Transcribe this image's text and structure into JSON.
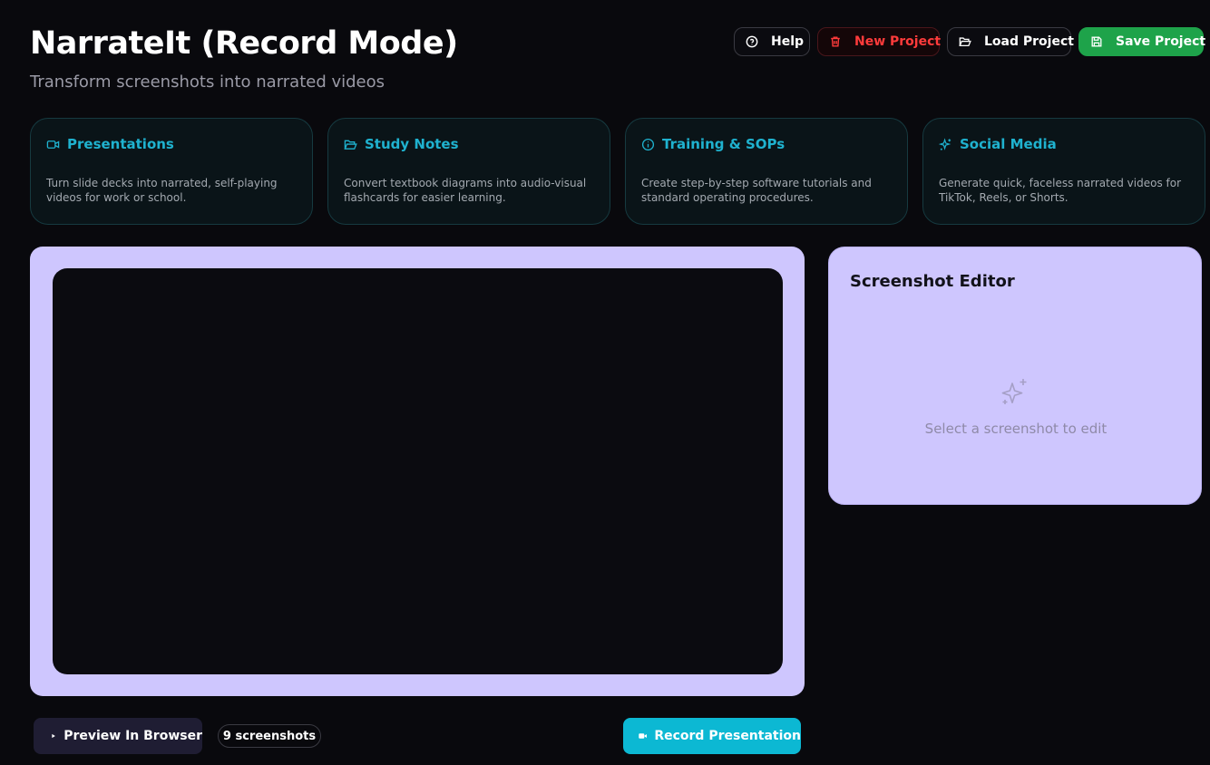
{
  "header": {
    "title": "NarrateIt (Record Mode)",
    "subtitle": "Transform screenshots into narrated videos"
  },
  "actions": {
    "help": "Help",
    "new_project": "New Project",
    "load_project": "Load Project",
    "save_project": "Save Project"
  },
  "use_cases": [
    {
      "title": "Presentations",
      "icon": "video-icon",
      "description": "Turn slide decks into narrated, self-playing videos for work or school."
    },
    {
      "title": "Study Notes",
      "icon": "folder-open-icon",
      "description": "Convert textbook diagrams into audio-visual flashcards for easier learning."
    },
    {
      "title": "Training & SOPs",
      "icon": "info-icon",
      "description": "Create step-by-step software tutorials and standard operating procedures."
    },
    {
      "title": "Social Media",
      "icon": "sparkles-icon",
      "description": "Generate quick, faceless narrated videos for TikTok, Reels, or Shorts."
    }
  ],
  "editor": {
    "title": "Screenshot Editor",
    "empty_text": "Select a screenshot to edit",
    "empty_icon": "sparkles-icon"
  },
  "bottom_bar": {
    "preview_label": "Preview In Browser",
    "screenshot_count": "9 screenshots",
    "record_label": "Record Presentation"
  },
  "colors": {
    "accent_cyan": "#0cb8d3",
    "panel_lavender": "#cec6fe",
    "danger_red": "#ff3b3b",
    "success_green": "#1ea34a"
  }
}
